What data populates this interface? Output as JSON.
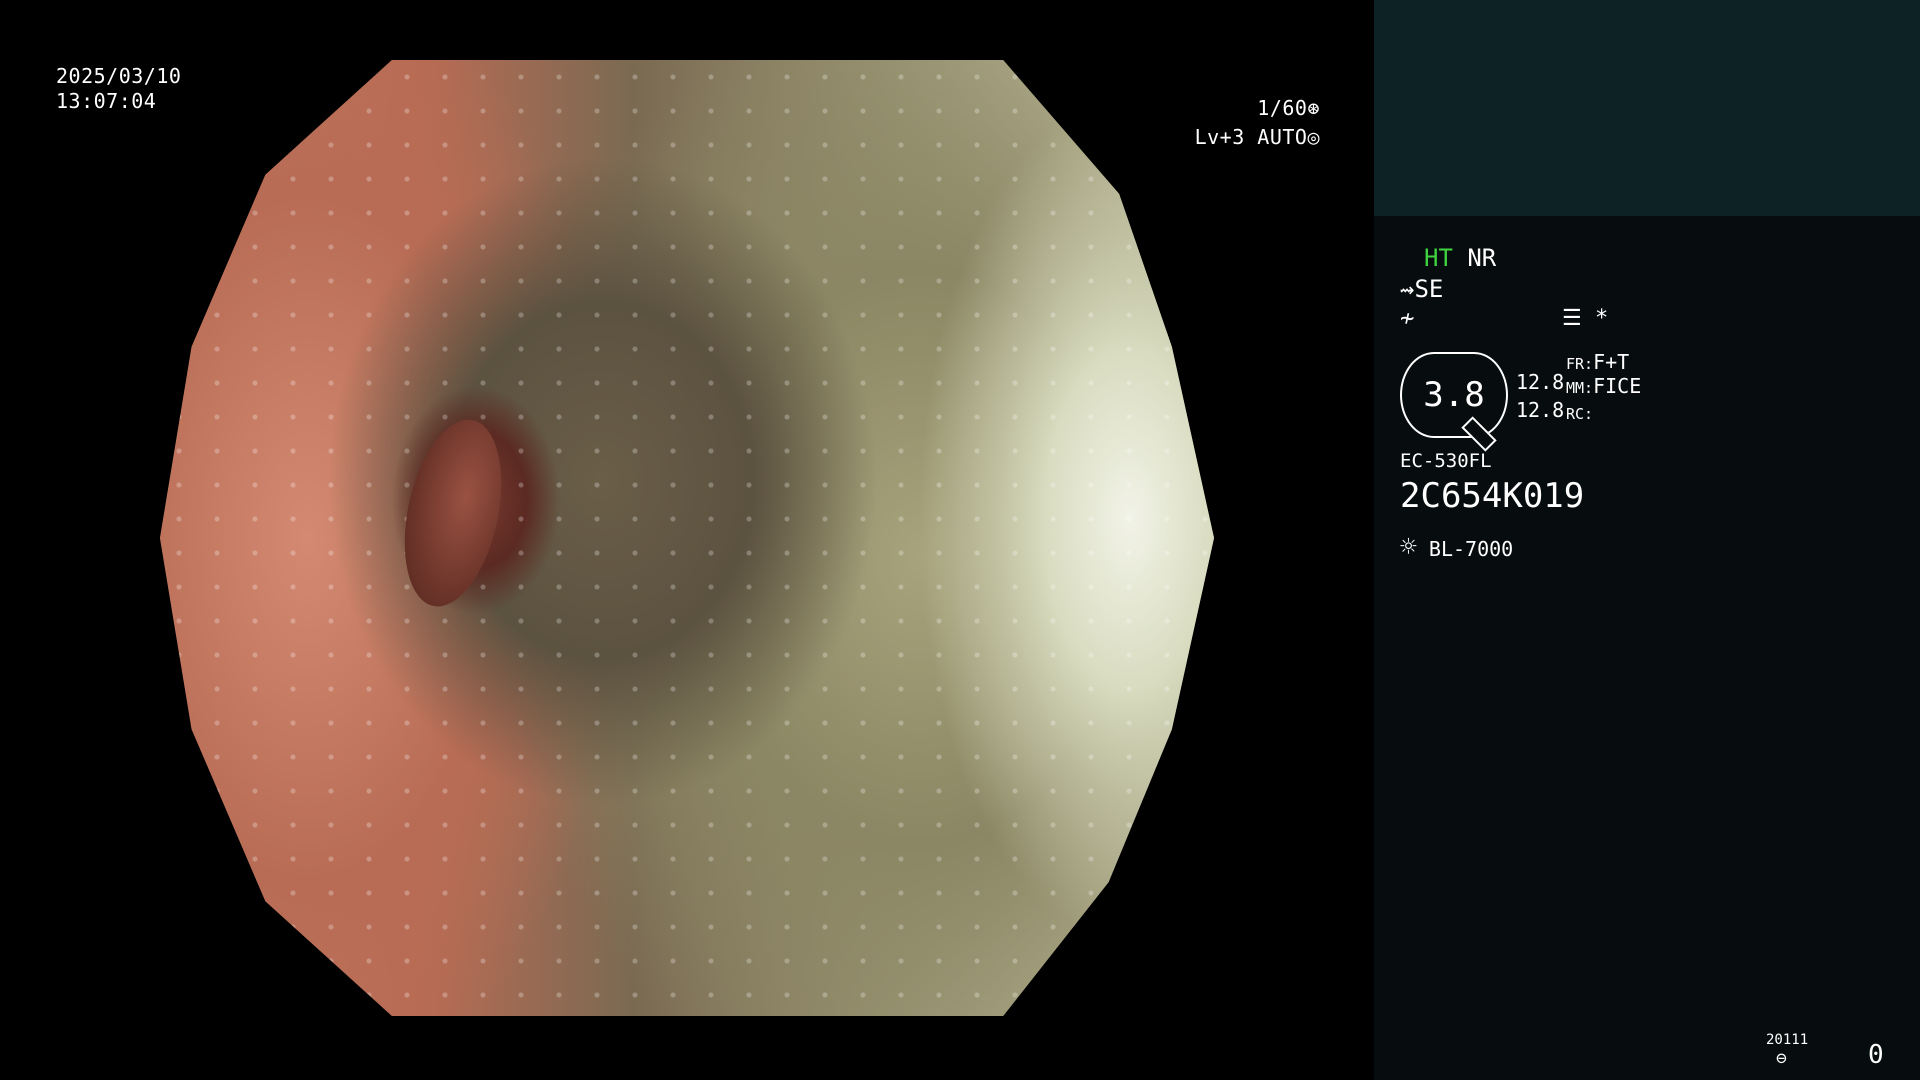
{
  "overlay": {
    "date": "2025/03/10",
    "time": "13:07:04",
    "shutter": "1/60",
    "shutter_icon": "aperture-icon",
    "exposure_level": "Lv+3 AUTO",
    "exposure_icon": "auto-iris-icon"
  },
  "panel": {
    "enhance_mode": "HT",
    "noise_reduction": "NR",
    "structure_enhance": "SE",
    "se_icon_glyph": "⇝",
    "color_icon_glyph": "≁",
    "menu_icon_glyph": "☰",
    "asterisk": "*",
    "zoom_value": "3.8",
    "value_top": "12.8",
    "value_bottom": "12.8",
    "fr_label": "FR:",
    "fr_value": "F+T",
    "mm_label": "MM:",
    "mm_value": "FICE",
    "rc_label": "RC:",
    "scope_model": "EC-530FL",
    "serial": "2C654K019",
    "light_source_icon": "☼",
    "light_source": "BL-7000",
    "record_code": "20111",
    "record_icon_glyph": "⊖",
    "counter": "0"
  },
  "colors": {
    "panel_top": "#0c2224",
    "panel_bg": "#070d0e",
    "accent_green": "#3fd43f"
  }
}
